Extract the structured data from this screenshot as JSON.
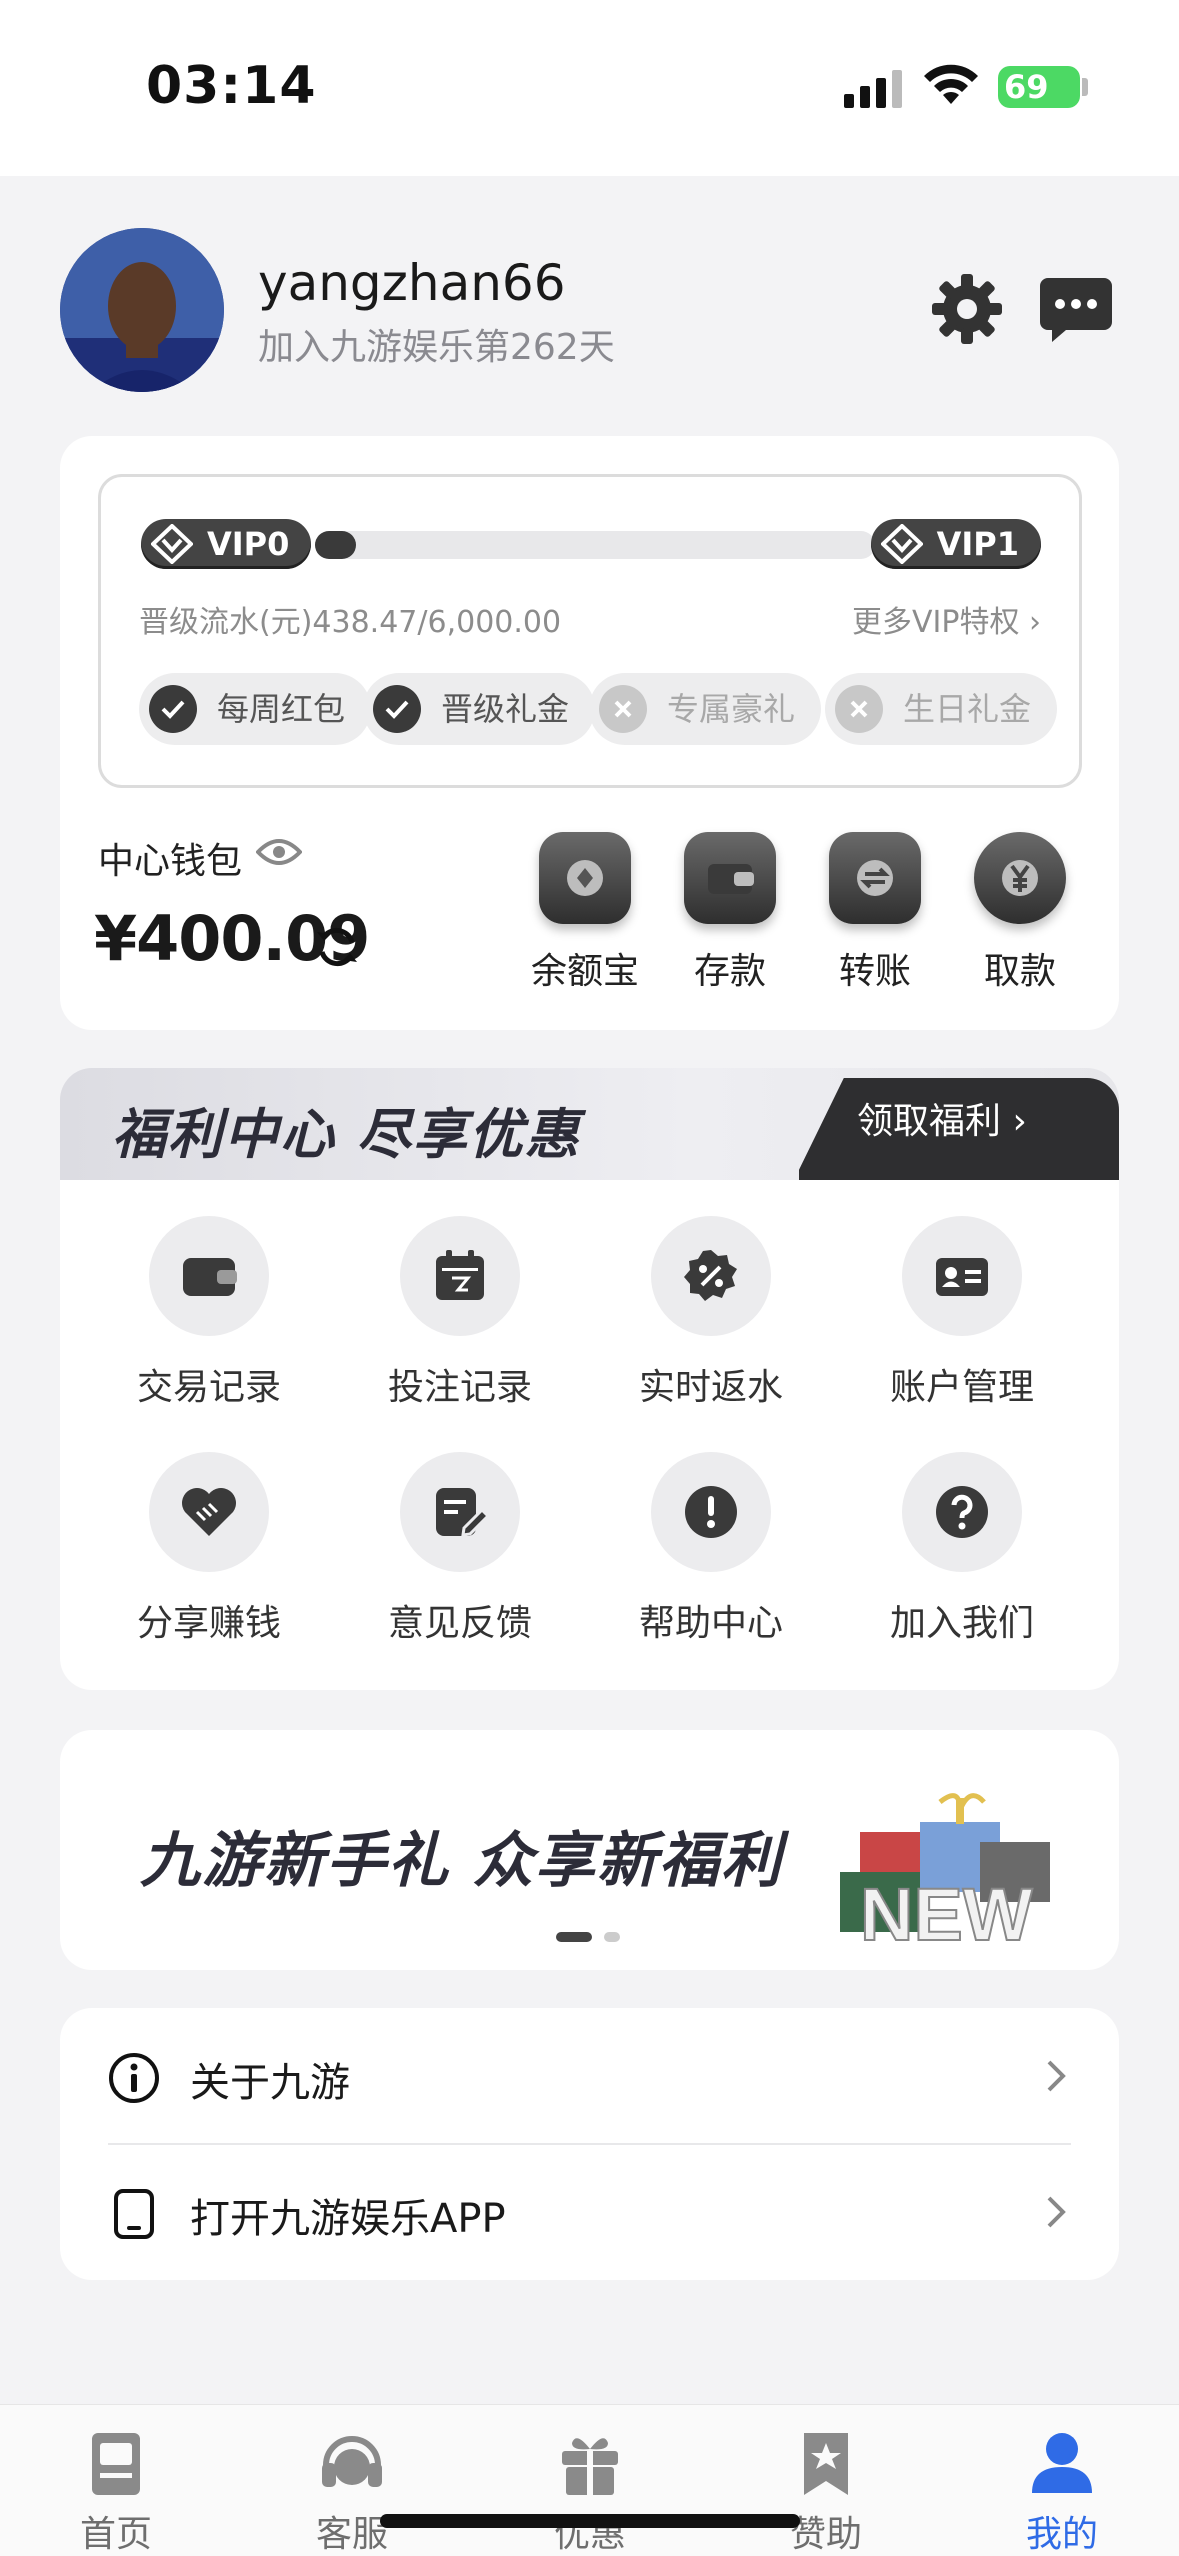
{
  "status_bar": {
    "time": "03:14",
    "battery": "69"
  },
  "profile": {
    "username": "yangzhan66",
    "join_text": "加入九游娱乐第262天"
  },
  "vip": {
    "current_level": "VIP0",
    "next_level": "VIP1",
    "progress_fraction": 0.073,
    "progress_text": "晋级流水(元)438.47/6,000.00",
    "more_link": "更多VIP特权 ›",
    "perks": [
      {
        "label": "每周红包",
        "unlocked": true
      },
      {
        "label": "晋级礼金",
        "unlocked": true
      },
      {
        "label": "专属豪礼",
        "unlocked": false
      },
      {
        "label": "生日礼金",
        "unlocked": false
      }
    ]
  },
  "wallet": {
    "label": "中心钱包",
    "amount": "¥400.09",
    "actions": [
      {
        "label": "余额宝",
        "icon": "balance-treasure-icon"
      },
      {
        "label": "存款",
        "icon": "wallet-icon"
      },
      {
        "label": "转账",
        "icon": "transfer-icon"
      },
      {
        "label": "取款",
        "icon": "yuan-icon"
      }
    ]
  },
  "welfare": {
    "title": "福利中心 尽享优惠",
    "claim_label": "领取福利 ›",
    "items": [
      {
        "label": "交易记录",
        "icon": "wallet-icon"
      },
      {
        "label": "投注记录",
        "icon": "calendar-icon"
      },
      {
        "label": "实时返水",
        "icon": "percent-badge-icon"
      },
      {
        "label": "账户管理",
        "icon": "id-card-icon"
      },
      {
        "label": "分享赚钱",
        "icon": "handshake-heart-icon"
      },
      {
        "label": "意见反馈",
        "icon": "edit-note-icon"
      },
      {
        "label": "帮助中心",
        "icon": "exclamation-icon"
      },
      {
        "label": "加入我们",
        "icon": "question-icon"
      }
    ]
  },
  "promo": {
    "text": "九游新手礼 众享新福利",
    "image_word": "NEW"
  },
  "links": [
    {
      "label": "关于九游",
      "icon": "info-icon"
    },
    {
      "label": "打开九游娱乐APP",
      "icon": "phone-icon"
    }
  ],
  "tabs": [
    {
      "label": "首页",
      "icon": "home-icon",
      "active": false
    },
    {
      "label": "客服",
      "icon": "headset-icon",
      "active": false
    },
    {
      "label": "优惠",
      "icon": "gift-icon",
      "active": false
    },
    {
      "label": "赞助",
      "icon": "bookmark-star-icon",
      "active": false
    },
    {
      "label": "我的",
      "icon": "user-icon",
      "active": true
    }
  ],
  "colors": {
    "accent": "#2f6be6",
    "dark": "#3a3a3a",
    "background": "#f3f3f5"
  }
}
